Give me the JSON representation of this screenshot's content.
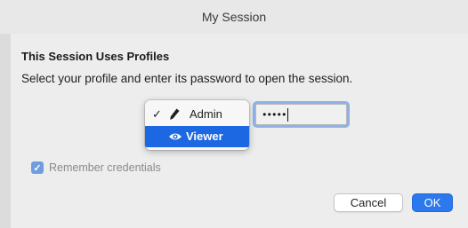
{
  "window": {
    "title": "My Session"
  },
  "dialog": {
    "heading": "This Session Uses Profiles",
    "message": "Select your profile and enter its password to open the session."
  },
  "profile_menu": {
    "items": [
      {
        "label": "Admin",
        "icon": "pencil-icon",
        "checked": true,
        "highlighted": false
      },
      {
        "label": "Viewer",
        "icon": "eye-icon",
        "checked": false,
        "highlighted": true
      }
    ],
    "check_glyph": "✓"
  },
  "password": {
    "masked_value": "•••••"
  },
  "remember": {
    "label": "Remember credentials",
    "checked": true,
    "check_glyph": "✓"
  },
  "buttons": {
    "cancel": "Cancel",
    "ok": "OK"
  },
  "colors": {
    "accent": "#1c68e3",
    "ok_button": "#2b79ed"
  }
}
